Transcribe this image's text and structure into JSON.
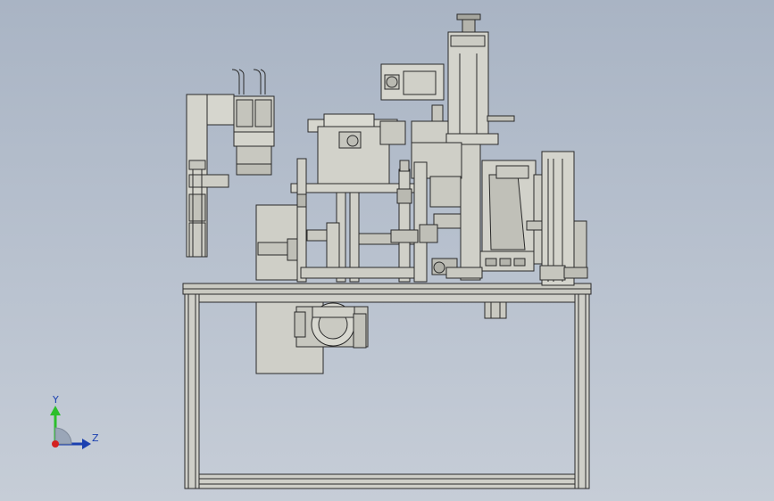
{
  "viewport": {
    "background_top": "#a9b4c4",
    "background_bottom": "#c6cdd7",
    "model_line_color": "#2a2a2a",
    "model_fill_color": "#d4d4cc",
    "model_shadow_color": "#b8b8b0"
  },
  "triad": {
    "y_label": "Y",
    "z_label": "Z",
    "y_axis_color": "#2bbf2b",
    "z_axis_color": "#1a3fb0",
    "x_axis_color": "#d42020",
    "icon": "coordinate-triad-icon"
  }
}
